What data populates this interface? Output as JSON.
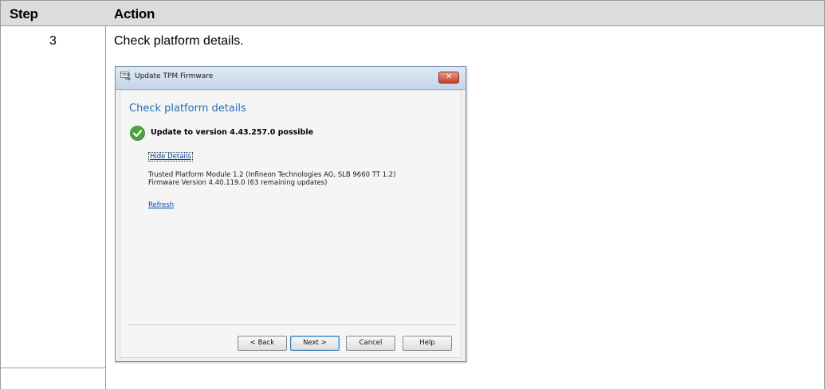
{
  "table": {
    "headers": {
      "step": "Step",
      "action": "Action"
    },
    "row": {
      "step": "3",
      "action": "Check platform details."
    }
  },
  "dialog": {
    "title": "Update TPM Firmware",
    "icon": "tpm-icon",
    "heading": "Check platform details",
    "status": "Update to version 4.43.257.0 possible",
    "hide_details_link": "Hide Details",
    "detail_line1": "Trusted Platform Module 1.2 (Infineon Technologies AG, SLB 9660 TT 1.2)",
    "detail_line2": "Firmware Version 4.40.119.0 (63 remaining updates)",
    "refresh_link": "Refresh",
    "buttons": {
      "back": "< Back",
      "next": "Next >",
      "cancel": "Cancel",
      "help": "Help"
    },
    "colors": {
      "heading": "#2b6cb0",
      "check": "#4aa63a",
      "close": "#c4402a"
    }
  }
}
